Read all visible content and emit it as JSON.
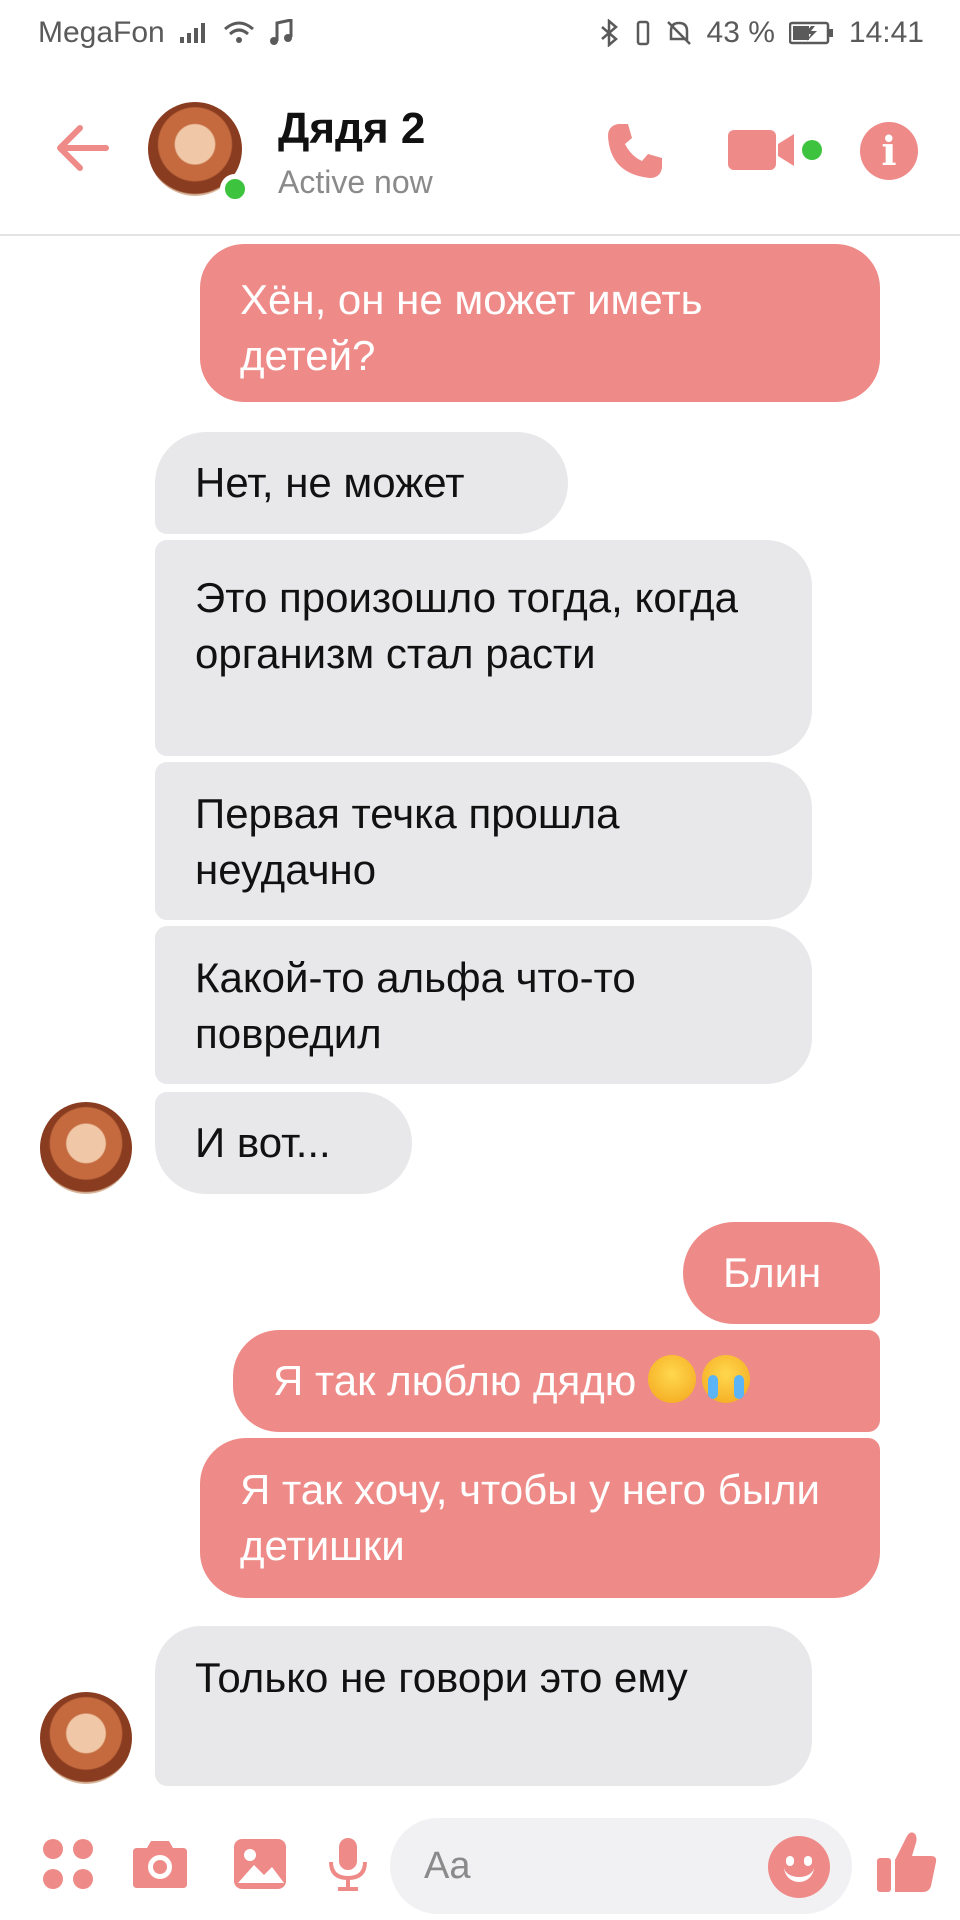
{
  "status_bar": {
    "carrier": "MegaFon",
    "battery": "43 %",
    "time": "14:41"
  },
  "header": {
    "contact_name": "Дядя 2",
    "contact_status": "Active now"
  },
  "messages": [
    {
      "direction": "outgoing",
      "text": "Хён, он не может иметь детей?"
    },
    {
      "direction": "incoming",
      "text": "Нет, не может"
    },
    {
      "direction": "incoming",
      "text": "Это произошло тогда, когда организм стал расти"
    },
    {
      "direction": "incoming",
      "text": "Первая течка прошла неудачно"
    },
    {
      "direction": "incoming",
      "text": "Какой-то альфа что-то повредил"
    },
    {
      "direction": "incoming",
      "text": "И вот..."
    },
    {
      "direction": "outgoing",
      "text": "Блин"
    },
    {
      "direction": "outgoing",
      "text": "Я так люблю дядю",
      "emoji": [
        "tired-face",
        "loudly-crying-face"
      ]
    },
    {
      "direction": "outgoing",
      "text": "Я так хочу, чтобы у него были детишки"
    },
    {
      "direction": "incoming",
      "text": "Только не говори это ему"
    }
  ],
  "composer": {
    "placeholder": "Aa"
  },
  "colors": {
    "accent": "#ee8b88",
    "incoming_bubble": "#e8e8ea",
    "online": "#3ec33e"
  },
  "icons": [
    "arrow-left-icon",
    "phone-icon",
    "video-camera-icon",
    "info-icon",
    "apps-icon",
    "camera-icon",
    "image-icon",
    "microphone-icon",
    "emoji-icon",
    "thumbs-up-icon"
  ]
}
